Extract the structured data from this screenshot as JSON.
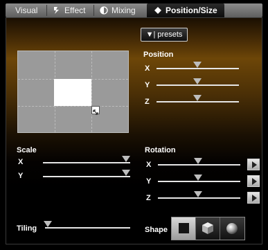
{
  "tabs": [
    {
      "label": "Visual",
      "icon": "none",
      "active": false
    },
    {
      "label": "Effect",
      "icon": "effect-icon",
      "active": false
    },
    {
      "label": "Mixing",
      "icon": "half-circle-icon",
      "active": false
    },
    {
      "label": "Position/Size",
      "icon": "diamond-icon",
      "active": true
    }
  ],
  "presets_label": "▼| presets",
  "position": {
    "title": "Position",
    "axes": [
      {
        "label": "X",
        "value": 0.5
      },
      {
        "label": "Y",
        "value": 0.5
      },
      {
        "label": "Z",
        "value": 0.5
      }
    ]
  },
  "scale": {
    "title": "Scale",
    "axes": [
      {
        "label": "X",
        "value": 1.0
      },
      {
        "label": "Y",
        "value": 1.0
      }
    ]
  },
  "rotation": {
    "title": "Rotation",
    "axes": [
      {
        "label": "X",
        "value": 0.5
      },
      {
        "label": "Y",
        "value": 0.5
      },
      {
        "label": "Z",
        "value": 0.5
      }
    ]
  },
  "tiling": {
    "title": "Tiling",
    "value": 0.0
  },
  "shape": {
    "title": "Shape",
    "options": [
      {
        "name": "square",
        "selected": true
      },
      {
        "name": "cube",
        "selected": false
      },
      {
        "name": "sphere",
        "selected": false
      }
    ]
  },
  "colors": {
    "accent_orange": "#6d4608",
    "panel_bg": "#000000"
  }
}
